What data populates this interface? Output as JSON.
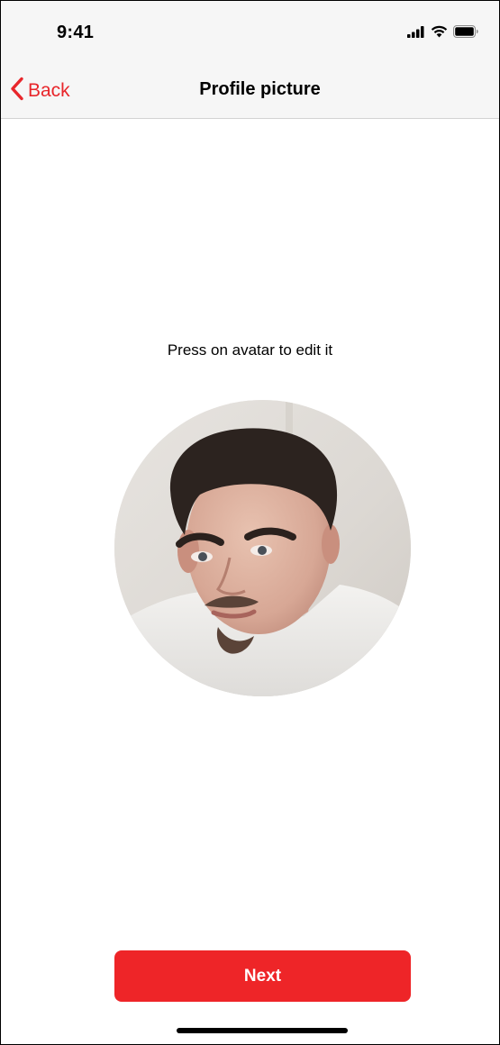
{
  "status_bar": {
    "time": "9:41",
    "icons": [
      "cellular-signal-icon",
      "wifi-icon",
      "battery-icon"
    ]
  },
  "nav": {
    "back_label": "Back",
    "title": "Profile picture"
  },
  "main": {
    "hint": "Press on avatar to edit it",
    "avatar_icon": "profile-photo"
  },
  "footer": {
    "next_label": "Next"
  },
  "colors": {
    "accent": "#ee2528",
    "bar_background": "#f6f6f6"
  }
}
